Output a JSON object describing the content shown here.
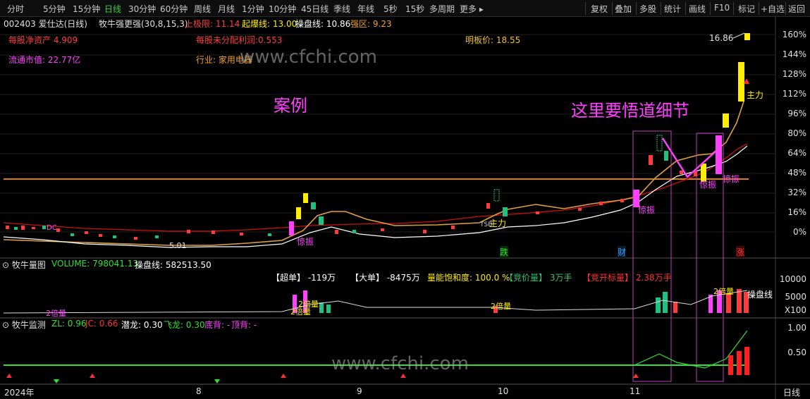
{
  "toolbar": {
    "left": [
      {
        "label": "分时",
        "active": false
      },
      {
        "label": "5分钟",
        "active": false
      },
      {
        "label": "15分钟",
        "active": false
      },
      {
        "label": "日线",
        "active": true
      },
      {
        "label": "30分钟",
        "active": false
      },
      {
        "label": "60分钟",
        "active": false
      },
      {
        "label": "周线",
        "active": false
      },
      {
        "label": "月线",
        "active": false
      },
      {
        "label": "1分钟",
        "active": false
      },
      {
        "label": "10分钟",
        "active": false
      },
      {
        "label": "45日线",
        "active": false
      },
      {
        "label": "季线",
        "active": false
      },
      {
        "label": "年线",
        "active": false
      },
      {
        "label": "5秒",
        "active": false
      },
      {
        "label": "15秒",
        "active": false
      },
      {
        "label": "多周期",
        "active": false
      },
      {
        "label": "更多",
        "active": false
      }
    ],
    "right": [
      "复权",
      "叠加",
      "多股",
      "统计",
      "画线",
      "F10",
      "标记",
      "+自选",
      "返回"
    ]
  },
  "header": {
    "stock": "002403 爱仕达(日线)",
    "indicator": "牧牛强更强(30,8,15,3)",
    "limit_label": "上极限:",
    "limit_value": "11.14",
    "burst_label": "起爆线:",
    "burst_value": "13.00",
    "cpx_label": "操盘线:",
    "cpx_value": "10.86",
    "strong_label": "强区:",
    "strong_value": "9.23"
  },
  "info": {
    "net_asset": "每股净资产 4.909",
    "undistributed": "每股未分配利润:0.553",
    "mingban": "明板价: 18.55",
    "float_cap": "流通市值: 22.77亿",
    "industry": "行业: 家用电器"
  },
  "annotations": {
    "case": "案例",
    "detail": "这里要悟道细节",
    "max_price": "16.86",
    "zhuli1": "主力",
    "zhuli2": "主力",
    "jingzhen1": "惊振",
    "jingzhen2": "惊振",
    "jingzhen3": "惊振",
    "jingzhen4": "惊振",
    "low_price": "5.01",
    "dc": "DC",
    "tsb": "TSB"
  },
  "price_axis": [
    "160%",
    "144%",
    "128%",
    "112%",
    "96%",
    "80%",
    "64%",
    "48%",
    "32%",
    "16%",
    "0%"
  ],
  "events": {
    "die": "跌",
    "cai": "财",
    "zhang": "涨"
  },
  "volume_panel": {
    "title": "牧牛量图",
    "volume_label": "VOLUME:",
    "volume_value": "798041.13",
    "cpx_label": "操盘线:",
    "cpx_value": "582513.50",
    "chaodan_label": "【超单】",
    "chaodan_value": "-119万",
    "dadan_label": "【大单】",
    "dadan_value": "-8475万",
    "baohedu_label": "量能饱和度:",
    "baohedu_value": "100.0 %",
    "jingjia_label": "【竞价量】",
    "jingjia_value": "3万手",
    "jingkai_label": "【竞开标量】",
    "jingkai_value": "2.38万手",
    "axis": [
      "10000",
      "5000"
    ],
    "unit": "X100",
    "line_label": "操盘线",
    "beiliang_labels": [
      "2倍量",
      "2倍量",
      "2倍量",
      "2倍量",
      "2倍量"
    ]
  },
  "monitor_panel": {
    "title": "牧牛监测",
    "zl_label": "ZL:",
    "zl_value": "0.96",
    "jc_label": "JC:",
    "jc_value": "0.66",
    "qianlong_label": "潜龙:",
    "qianlong_value": "0.30",
    "feilong_label": "飞龙:",
    "feilong_value": "0.30",
    "dibei_label": "底背:",
    "dibei_value": "-",
    "dingbei_label": "顶背:",
    "dingbei_value": "-",
    "axis": [
      "1.00",
      "0.50"
    ]
  },
  "date_axis": {
    "labels": [
      "2024年",
      "8",
      "9",
      "10",
      "11"
    ],
    "period": "日线"
  },
  "watermark": "www.cfchi.com",
  "colors": {
    "up": "#ff3b3b",
    "down": "#20c080",
    "yellow": "#ffee00",
    "magenta": "#ff40ff",
    "orange": "#f0a020"
  }
}
